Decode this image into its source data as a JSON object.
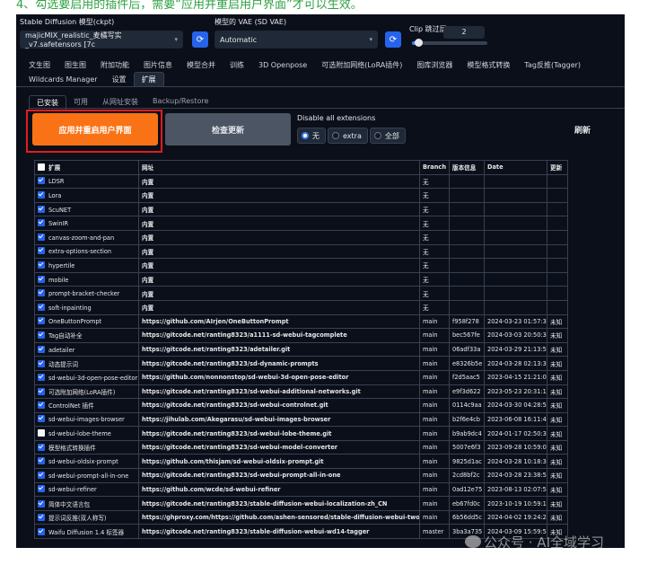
{
  "caption": "4、勾选要启用的插件后，需要“应用并重启用户界面”才可以生效。",
  "settings": {
    "model_label": "Stable Diffusion 模型(ckpt)",
    "model_value": "majicMIX_realistic_麦橘写实_v7.safetensors [7c",
    "vae_label": "模型的 VAE (SD VAE)",
    "vae_value": "Automatic",
    "clip_label": "Clip 跳过层",
    "clip_value": "2",
    "clip_fraction": 0.08,
    "refresh_icon": "refresh-icon",
    "dropdown_arrow": "▾"
  },
  "main_tabs": {
    "row1": [
      "文生图",
      "图生图",
      "附加功能",
      "图片信息",
      "模型合并",
      "训练",
      "3D Openpose",
      "可选附加网络(LoRA插件)",
      "图库浏览器",
      "模型格式转换",
      "Tag反推(Tagger)"
    ],
    "row2": [
      "Wildcards Manager",
      "设置",
      "扩展"
    ]
  },
  "sub_tabs": [
    "已安装",
    "可用",
    "从网址安装",
    "Backup/Restore"
  ],
  "actions": {
    "apply_label": "应用并重启用户界面",
    "check_label": "检查更新",
    "disable_label": "Disable all extensions",
    "radio_options": [
      "无",
      "extra",
      "全部"
    ],
    "radio_selected": "无",
    "refresh_label": "刷新"
  },
  "table": {
    "headers": [
      "扩展",
      "网址",
      "Branch",
      "版本信息",
      "Date",
      "更新"
    ],
    "rows": [
      {
        "checked": true,
        "name": "LDSR",
        "url": "内置",
        "branch": "无",
        "version": "",
        "date": "",
        "update": ""
      },
      {
        "checked": true,
        "name": "Lora",
        "url": "内置",
        "branch": "无",
        "version": "",
        "date": "",
        "update": ""
      },
      {
        "checked": true,
        "name": "ScuNET",
        "url": "内置",
        "branch": "无",
        "version": "",
        "date": "",
        "update": ""
      },
      {
        "checked": true,
        "name": "SwinIR",
        "url": "内置",
        "branch": "无",
        "version": "",
        "date": "",
        "update": ""
      },
      {
        "checked": true,
        "name": "canvas-zoom-and-pan",
        "url": "内置",
        "branch": "无",
        "version": "",
        "date": "",
        "update": ""
      },
      {
        "checked": true,
        "name": "extra-options-section",
        "url": "内置",
        "branch": "无",
        "version": "",
        "date": "",
        "update": ""
      },
      {
        "checked": true,
        "name": "hypertile",
        "url": "内置",
        "branch": "无",
        "version": "",
        "date": "",
        "update": ""
      },
      {
        "checked": true,
        "name": "mobile",
        "url": "内置",
        "branch": "无",
        "version": "",
        "date": "",
        "update": ""
      },
      {
        "checked": true,
        "name": "prompt-bracket-checker",
        "url": "内置",
        "branch": "无",
        "version": "",
        "date": "",
        "update": ""
      },
      {
        "checked": true,
        "name": "soft-inpainting",
        "url": "内置",
        "branch": "无",
        "version": "",
        "date": "",
        "update": ""
      },
      {
        "checked": true,
        "name": "OneButtonPrompt",
        "url": "https://github.com/AIrjen/OneButtonPrompt",
        "branch": "main",
        "version": "f958f278",
        "date": "2024-03-23 01:57:31",
        "update": "未知"
      },
      {
        "checked": true,
        "name": "Tag自动补全",
        "url": "https://gitcode.net/ranting8323/a1111-sd-webui-tagcomplete",
        "branch": "main",
        "version": "bec567fe",
        "date": "2024-03-03 20:50:33",
        "update": "未知"
      },
      {
        "checked": true,
        "name": "adetailer",
        "url": "https://gitcode.net/ranting8323/adetailer.git",
        "branch": "main",
        "version": "06adf33a",
        "date": "2024-03-29 21:13:54",
        "update": "未知"
      },
      {
        "checked": true,
        "name": "动态提示词",
        "url": "https://gitcode.net/ranting8323/sd-dynamic-prompts",
        "branch": "main",
        "version": "e8326b5e",
        "date": "2024-03-28 02:13:36",
        "update": "未知"
      },
      {
        "checked": true,
        "name": "sd-webui-3d-open-pose-editor",
        "url": "https://github.com/nonnonstop/sd-webui-3d-open-pose-editor",
        "branch": "main",
        "version": "f2d5aac5",
        "date": "2023-04-15 21:21:06",
        "update": "未知"
      },
      {
        "checked": true,
        "name": "可选附加网络(LoRA插件)",
        "url": "https://gitcode.net/ranting8323/sd-webui-additional-networks.git",
        "branch": "main",
        "version": "e9f3d622",
        "date": "2023-05-23 20:31:15",
        "update": "未知"
      },
      {
        "checked": true,
        "name": "ControlNet 插件",
        "url": "https://gitcode.net/ranting8323/sd-webui-controlnet.git",
        "branch": "main",
        "version": "0114c9aa",
        "date": "2024-03-30 04:28:57",
        "update": "未知"
      },
      {
        "checked": true,
        "name": "sd-webui-images-browser",
        "url": "https://jihulab.com/Akegarasu/sd-webui-images-browser",
        "branch": "main",
        "version": "b2f6e4cb",
        "date": "2023-06-08 16:11:43",
        "update": "未知"
      },
      {
        "checked": false,
        "name": "sd-webui-lobe-theme",
        "url": "https://gitcode.net/ranting8323/sd-webui-lobe-theme.git",
        "branch": "main",
        "version": "b9ab9dc4",
        "date": "2024-01-17 02:50:35",
        "update": "未知"
      },
      {
        "checked": true,
        "name": "模型格式转换插件",
        "url": "https://gitcode.net/ranting8323/sd-webui-model-converter",
        "branch": "main",
        "version": "5007e6f3",
        "date": "2023-09-28 10:59:04",
        "update": "未知"
      },
      {
        "checked": true,
        "name": "sd-webui-oldsix-prompt",
        "url": "https://github.com/thisjam/sd-webui-oldsix-prompt.git",
        "branch": "main",
        "version": "9825d1ac",
        "date": "2024-03-28 10:18:35",
        "update": "未知"
      },
      {
        "checked": true,
        "name": "sd-webui-prompt-all-in-one",
        "url": "https://gitcode.net/ranting8323/sd-webui-prompt-all-in-one",
        "branch": "main",
        "version": "2cd8bf2c",
        "date": "2024-03-28 23:38:57",
        "update": "未知"
      },
      {
        "checked": true,
        "name": "sd-webui-refiner",
        "url": "https://github.com/wcde/sd-webui-refiner",
        "branch": "main",
        "version": "0ad12e75",
        "date": "2023-08-13 02:07:55",
        "update": "未知"
      },
      {
        "checked": true,
        "name": "简体中文语言包",
        "url": "https://gitcode.net/ranting8323/stable-diffusion-webui-localization-zh_CN",
        "branch": "main",
        "version": "eb67fd0c",
        "date": "2023-10-19 10:59:19",
        "update": "未知"
      },
      {
        "checked": true,
        "name": "提示词反推(双人称写)",
        "url": "https://ghproxy.com/https://github.com/ashen-sensored/stable-diffusion-webui-two-shot.git",
        "branch": "main",
        "version": "6b56dd5c",
        "date": "2024-04-02 19:24:21",
        "update": "未知"
      },
      {
        "checked": true,
        "name": "Waifu Diffusion 1.4 标签器",
        "url": "https://gitcode.net/ranting8323/stable-diffusion-webui-wd14-tagger",
        "branch": "master",
        "version": "3ba3a735",
        "date": "2024-03-09 15:59:56",
        "update": "未知"
      }
    ]
  },
  "watermark": "公众号 · AI全域学习"
}
